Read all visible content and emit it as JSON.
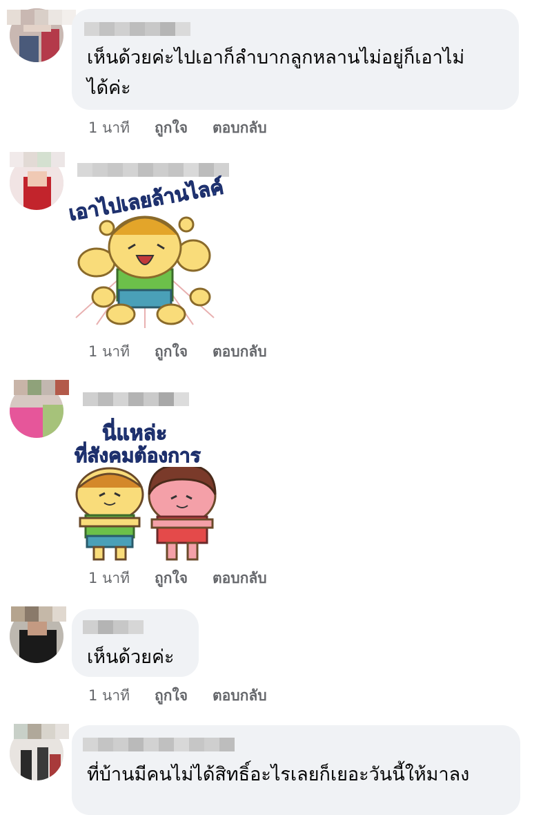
{
  "comments": [
    {
      "text": "เห็นด้วยค่ะไปเอาก็ลำบากลูกหลานไม่อยู่ก็เอาไม่\nได้ค่ะ",
      "time": "1 นาที",
      "like": "ถูกใจ",
      "reply": "ตอบกลับ"
    },
    {
      "sticker_caption": "เอาไปเลยล้านไลค์",
      "time": "1 นาที",
      "like": "ถูกใจ",
      "reply": "ตอบกลับ"
    },
    {
      "sticker_caption_line1": "นี่แหล่ะ",
      "sticker_caption_line2": "ที่สังคมต้องการ",
      "time": "1 นาที",
      "like": "ถูกใจ",
      "reply": "ตอบกลับ"
    },
    {
      "text": "เห็นด้วยค่ะ",
      "time": "1 นาที",
      "like": "ถูกใจ",
      "reply": "ตอบกลับ"
    },
    {
      "text": "ที่บ้านมีคนไม่ได้สิทธิ์อะไรเลยก็เยอะวันนี้ให้มาลง"
    }
  ],
  "colors": {
    "bubble": "#f0f2f5",
    "action_text": "#65676b",
    "text": "#050505"
  }
}
